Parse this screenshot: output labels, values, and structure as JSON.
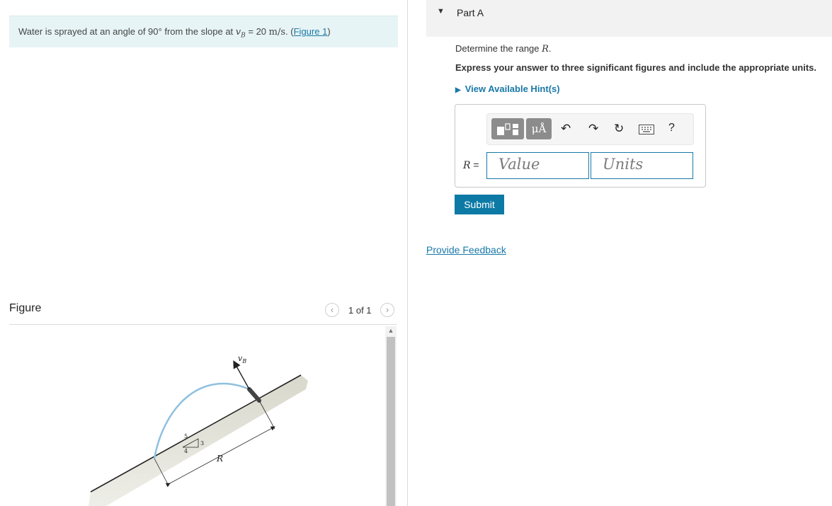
{
  "problem": {
    "text_before": "Water is sprayed at an angle of 90° from the slope at ",
    "var_main": "v",
    "var_sub": "B",
    "eq": " = 20 ",
    "units": "m/s",
    "text_after": ". (",
    "figure_link": "Figure 1",
    "close_paren": ")"
  },
  "figure_panel": {
    "title": "Figure",
    "pager": "1 of 1",
    "prev_icon": "chevron-left-icon",
    "next_icon": "chevron-right-icon",
    "labels": {
      "velocity_main": "v",
      "velocity_sub": "B",
      "range": "R",
      "slope_hyp": "5",
      "slope_rise": "3",
      "slope_run": "4"
    }
  },
  "part": {
    "title": "Part A",
    "prompt_text": "Determine the range ",
    "prompt_var": "R",
    "prompt_end": ".",
    "instruction": "Express your answer to three significant figures and include the appropriate units.",
    "hint": "View Available Hint(s)",
    "answer_label": "R",
    "answer_eq": " =",
    "value_placeholder": "Value",
    "units_placeholder": "Units",
    "submit": "Submit",
    "unit_symbol": "μÅ",
    "help": "?"
  },
  "feedback": "Provide Feedback",
  "colors": {
    "accent": "#1a78a8",
    "submit_bg": "#0c7aa5",
    "problem_bg": "#e7f4f6",
    "water": "#8fc0e0"
  }
}
